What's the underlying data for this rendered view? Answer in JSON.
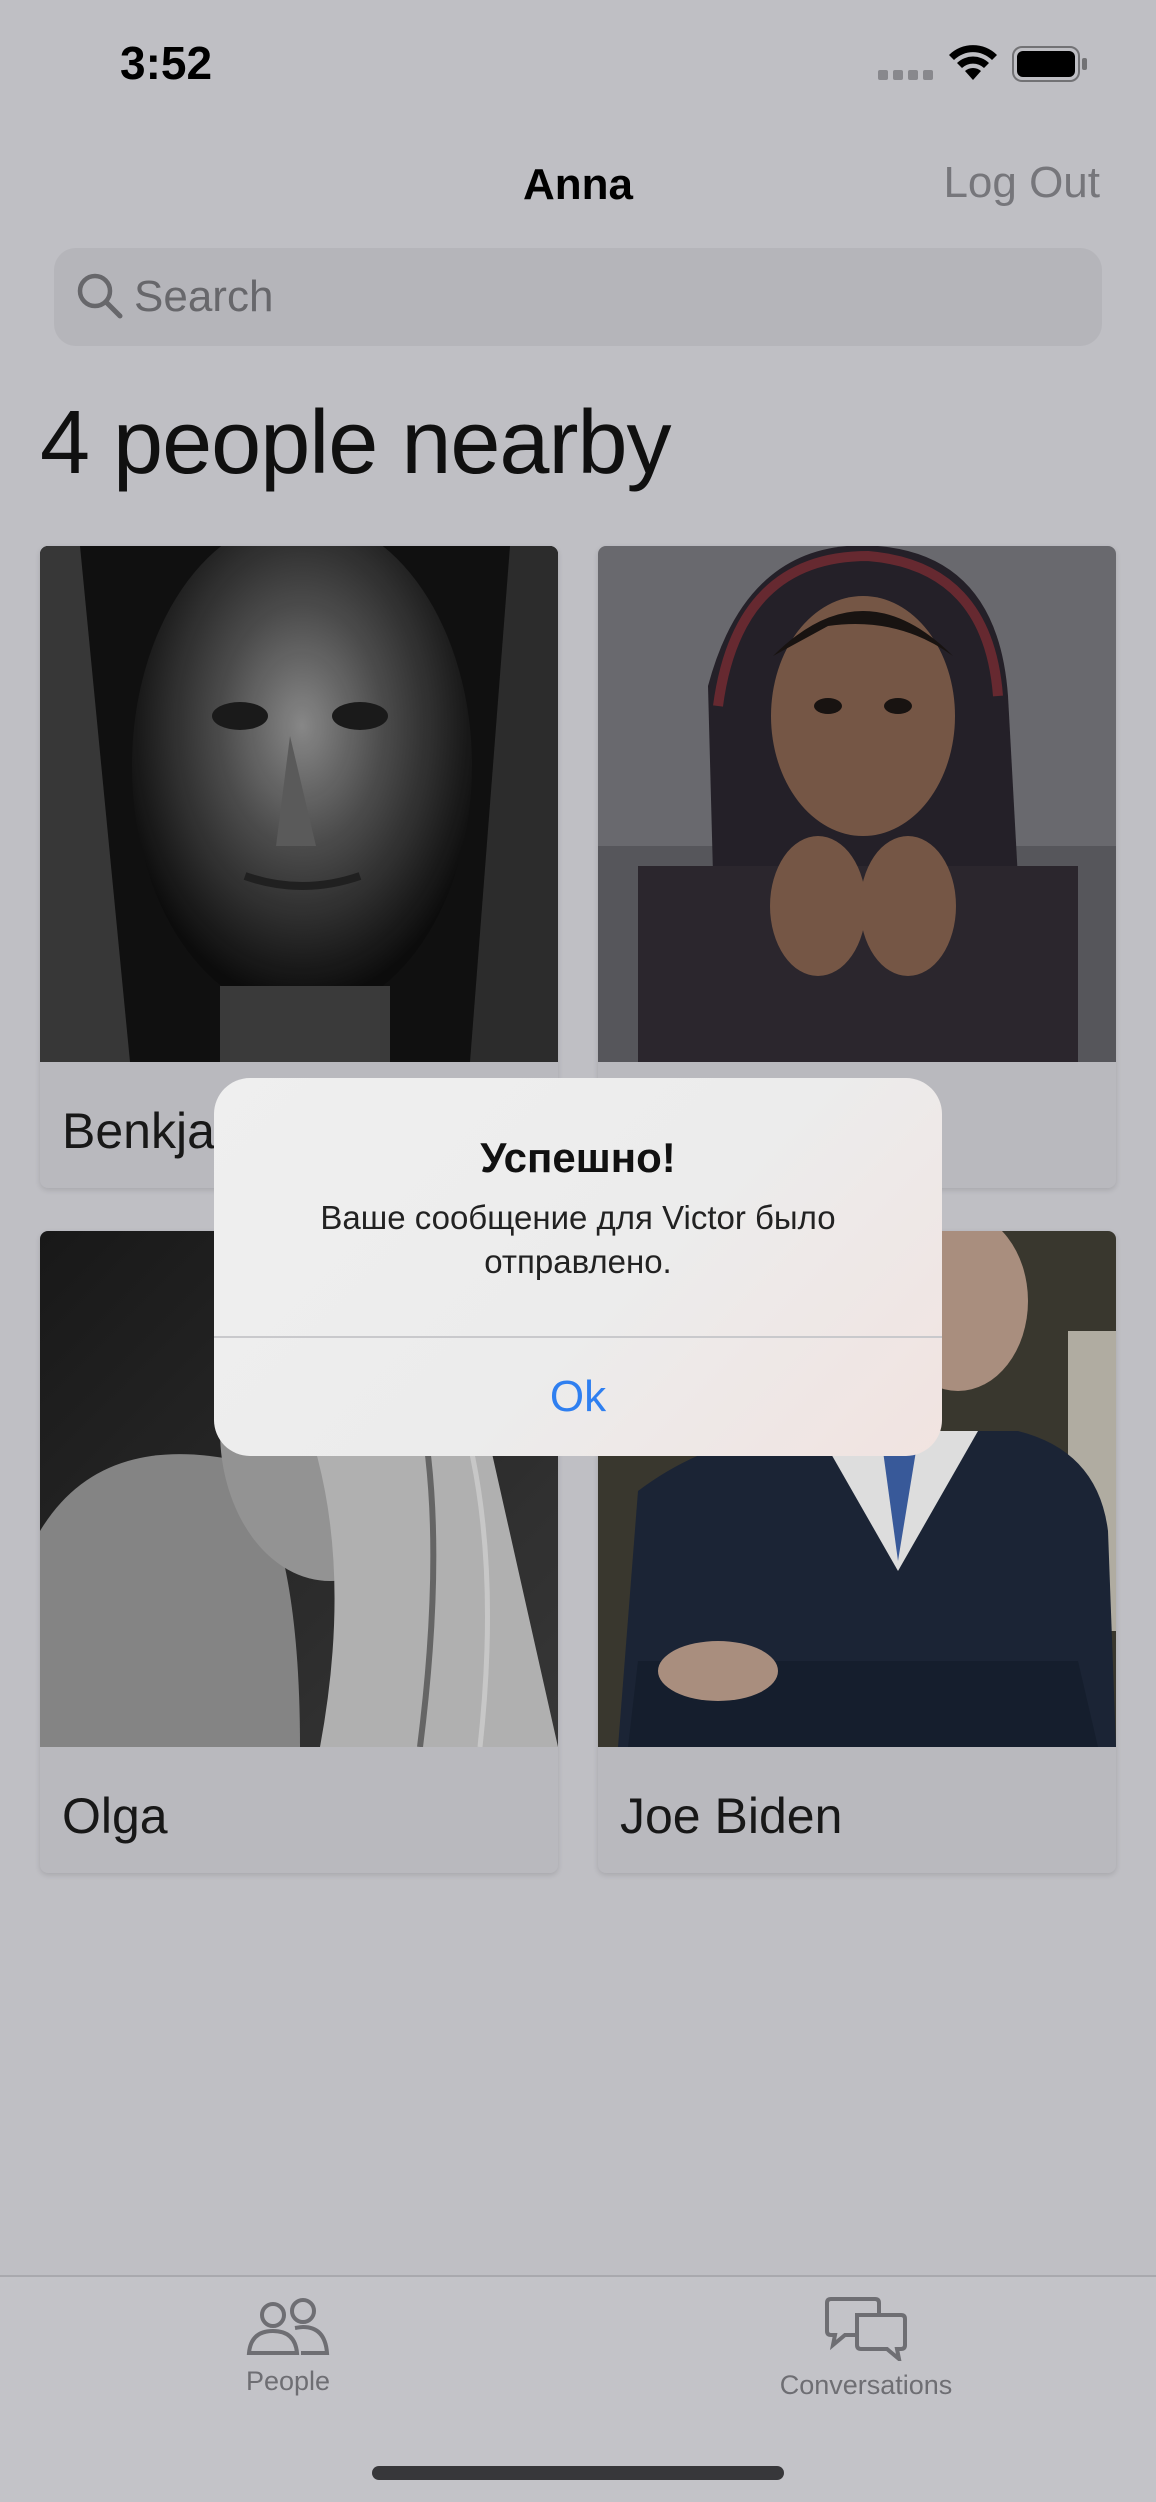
{
  "status_bar": {
    "time": "3:52"
  },
  "nav": {
    "title": "Anna",
    "logout_label": "Log Out"
  },
  "search": {
    "placeholder": "Search"
  },
  "people": {
    "count_label": "4 people nearby",
    "cards": [
      {
        "name": "Benkja"
      },
      {
        "name": ""
      },
      {
        "name": "Olga"
      },
      {
        "name": "Joe Biden"
      }
    ]
  },
  "alert": {
    "title": "Успешно!",
    "message": "Ваше сообщение для Victor было отправлено.",
    "ok_label": "Ok"
  },
  "tabs": [
    {
      "label": "People",
      "icon": "people-icon"
    },
    {
      "label": "Conversations",
      "icon": "conversations-icon"
    }
  ],
  "colors": {
    "accent": "#2f7ff0",
    "background": "#c7c7cc"
  }
}
